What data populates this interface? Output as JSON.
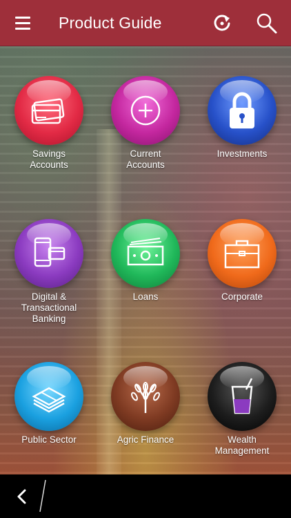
{
  "app_bar": {
    "title": "Product Guide",
    "menu_icon": "hamburger-menu-icon",
    "refresh_icon": "refresh-icon",
    "search_icon": "search-icon",
    "color": "#9e2f3a"
  },
  "products": [
    {
      "label": "Savings\nAccounts",
      "icon": "credit-card-icon",
      "color": "#e22a45"
    },
    {
      "label": "Current\nAccounts",
      "icon": "plus-circle-icon",
      "color": "#c4279f"
    },
    {
      "label": "Investments",
      "icon": "padlock-icon",
      "color": "#2751c9"
    },
    {
      "label": "Digital &\nTransactional\nBanking",
      "icon": "phone-card-icon",
      "color": "#8b3bc0"
    },
    {
      "label": "Loans",
      "icon": "cash-stack-icon",
      "color": "#20b85a"
    },
    {
      "label": "Corporate",
      "icon": "briefcase-icon",
      "color": "#f06a1b"
    },
    {
      "label": "Public Sector",
      "icon": "money-bundle-icon",
      "color": "#1aa0e0"
    },
    {
      "label": "Agric Finance",
      "icon": "wheat-icon",
      "color": "#7e3a22"
    },
    {
      "label": "Wealth\nManagement",
      "icon": "drink-glass-icon",
      "color": "#1d1d1d"
    }
  ],
  "nav_bar": {
    "back_icon": "back-chevron-icon"
  }
}
